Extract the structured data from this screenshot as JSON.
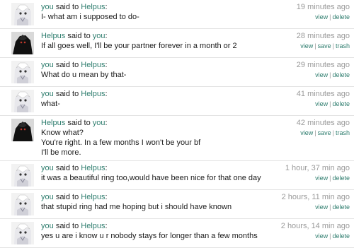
{
  "users": {
    "you": "you",
    "other": "Helpus"
  },
  "labels": {
    "said_to": "said to",
    "colon": ":",
    "view": "view",
    "save": "save",
    "trash": "trash",
    "delete": "delete",
    "sep": "|"
  },
  "colors": {
    "link": "#2e7d6e",
    "time": "#9a9a9a"
  },
  "messages": [
    {
      "from": "you",
      "to": "Helpus",
      "avatar": "anime-avatar",
      "lines": [
        "I- what am i supposed to do-"
      ],
      "time": "19 minutes ago",
      "actions": [
        "view",
        "delete"
      ]
    },
    {
      "from": "Helpus",
      "to": "you",
      "avatar": "dark-avatar",
      "lines": [
        "If all goes well, I'll be your partner forever in a month or 2"
      ],
      "time": "28 minutes ago",
      "actions": [
        "view",
        "save",
        "trash"
      ]
    },
    {
      "from": "you",
      "to": "Helpus",
      "avatar": "anime-avatar",
      "lines": [
        "What do u mean by that-"
      ],
      "time": "29 minutes ago",
      "actions": [
        "view",
        "delete"
      ]
    },
    {
      "from": "you",
      "to": "Helpus",
      "avatar": "anime-avatar",
      "lines": [
        "what-"
      ],
      "time": "41 minutes ago",
      "actions": [
        "view",
        "delete"
      ]
    },
    {
      "from": "Helpus",
      "to": "you",
      "avatar": "dark-avatar",
      "lines": [
        "Know what?",
        "You're right. In a few months I won't be your bf",
        "I'll be more."
      ],
      "time": "42 minutes ago",
      "actions": [
        "view",
        "save",
        "trash"
      ]
    },
    {
      "from": "you",
      "to": "Helpus",
      "avatar": "anime-avatar",
      "lines": [
        "it was a beautiful ring too,would have been nice for that one day"
      ],
      "time": "1 hour, 37 min ago",
      "actions": [
        "view",
        "delete"
      ]
    },
    {
      "from": "you",
      "to": "Helpus",
      "avatar": "anime-avatar",
      "lines": [
        "that stupid ring had me hoping but i should have known"
      ],
      "time": "2 hours, 11 min ago",
      "actions": [
        "view",
        "delete"
      ]
    },
    {
      "from": "you",
      "to": "Helpus",
      "avatar": "anime-avatar",
      "lines": [
        "yes u are i know u r nobody stays for longer than a few months"
      ],
      "time": "2 hours, 14 min ago",
      "actions": [
        "view",
        "delete"
      ]
    }
  ]
}
